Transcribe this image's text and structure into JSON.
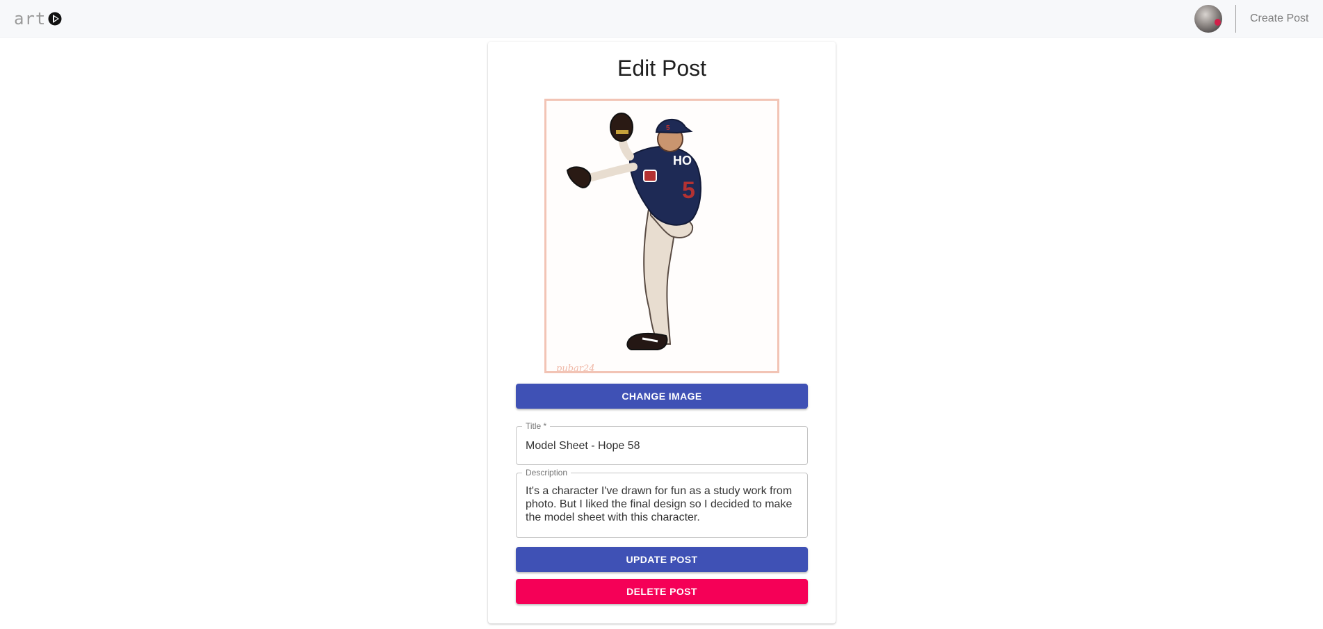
{
  "nav": {
    "logo_text": "art",
    "create_post": "Create Post"
  },
  "form": {
    "heading": "Edit Post",
    "image": {
      "signature": "pubar24"
    },
    "change_image_label": "CHANGE IMAGE",
    "title_field": {
      "label": "Title *",
      "value": "Model Sheet - Hope 58"
    },
    "description_field": {
      "label": "Description",
      "value": "It's a character I've drawn for fun as a study work from photo. But I liked the final design so I decided to make the model sheet with this character."
    },
    "update_label": "UPDATE POST",
    "delete_label": "DELETE POST"
  },
  "colors": {
    "primary": "#3f51b5",
    "danger": "#f50057",
    "nav_bg": "#f7f8fa",
    "art_border": "#f2c4b5"
  },
  "icons": [
    "play-triangle-icon",
    "avatar"
  ]
}
